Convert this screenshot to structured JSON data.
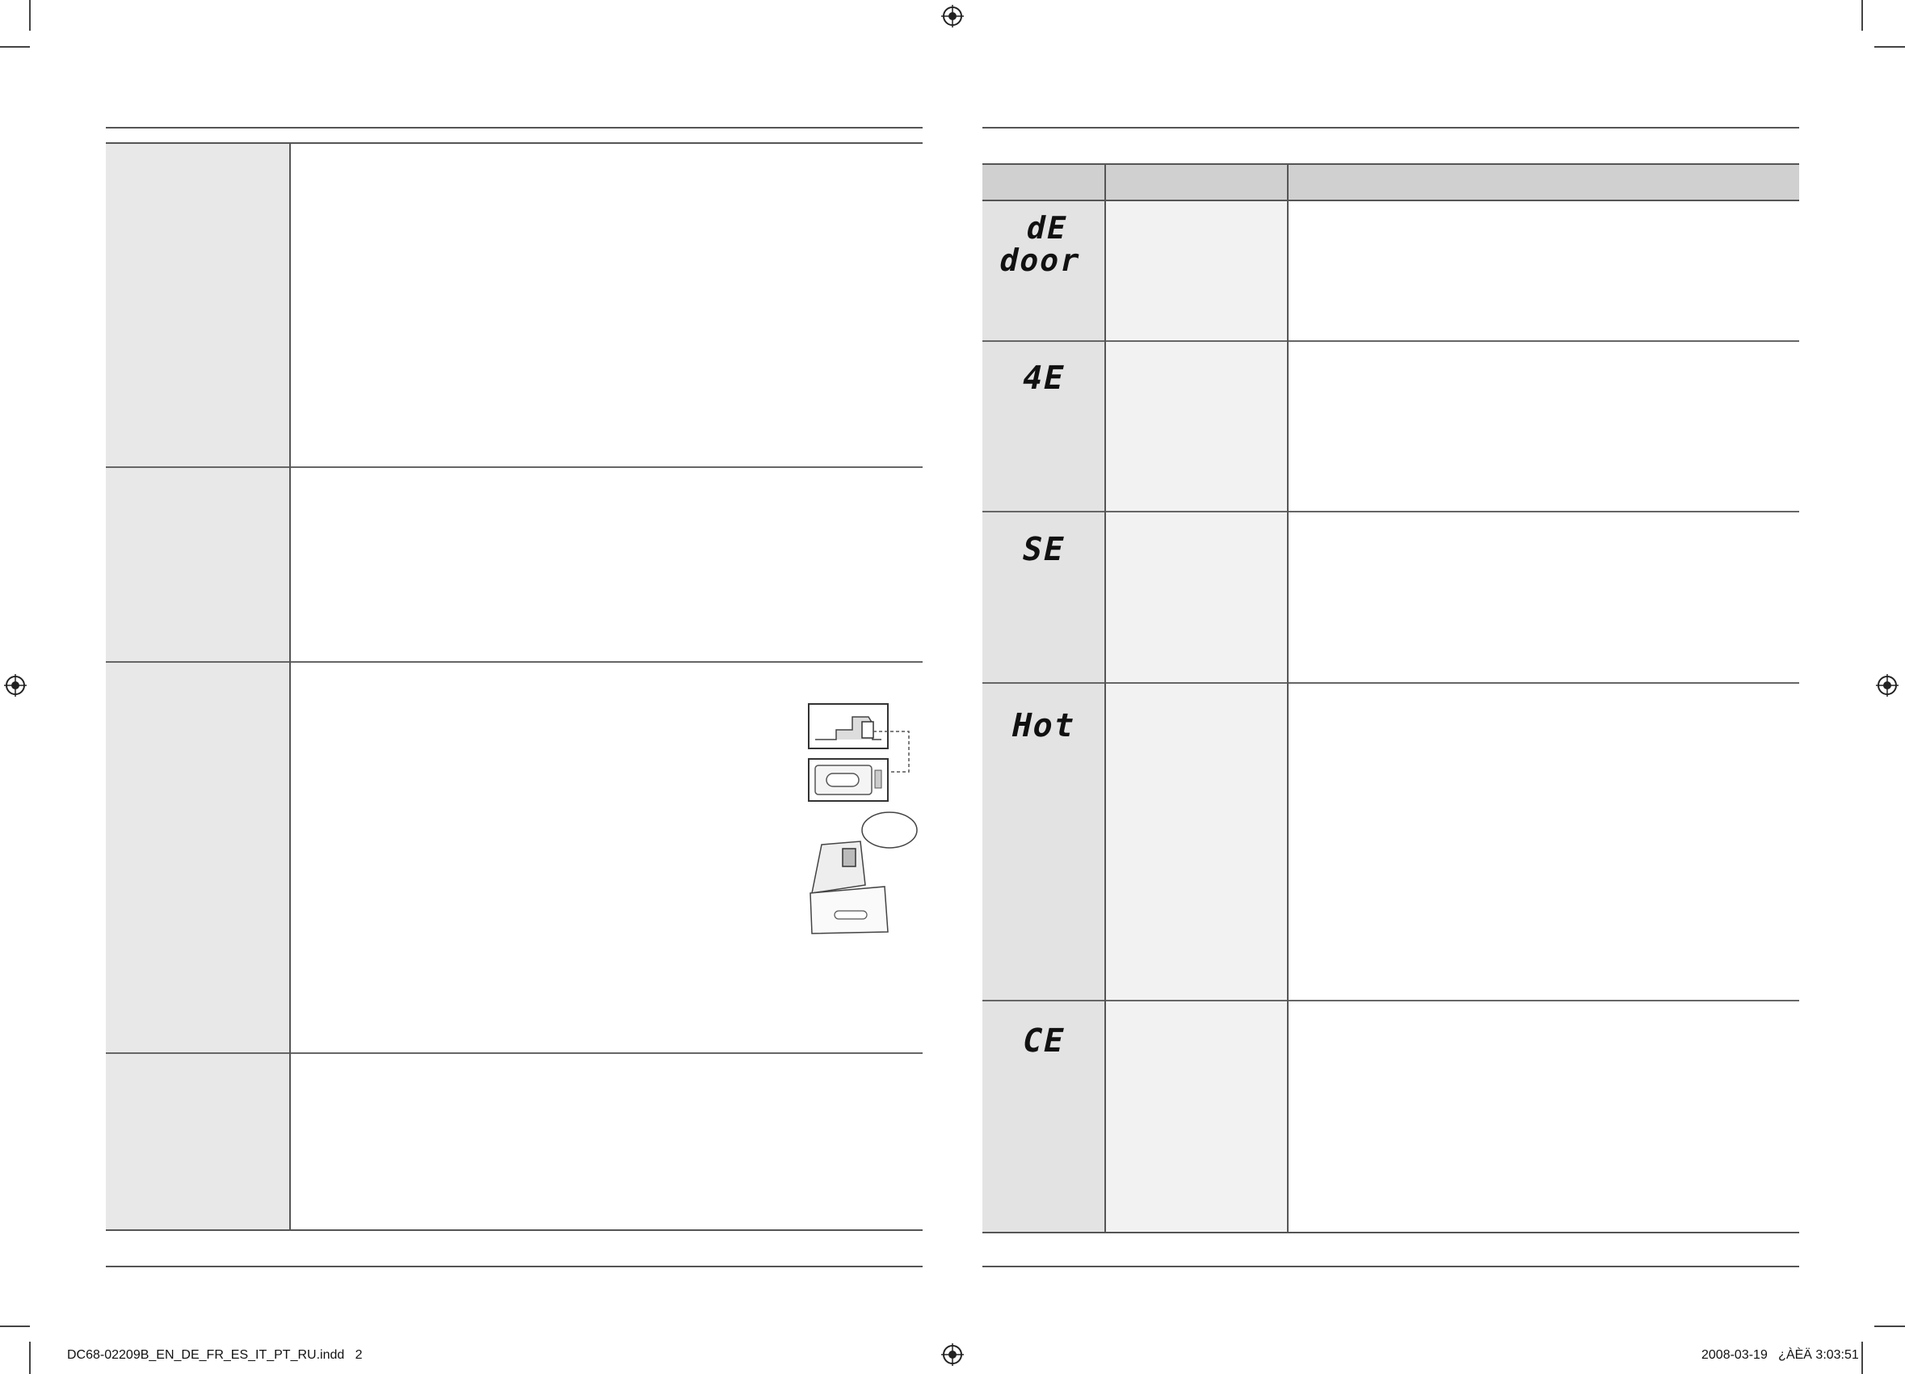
{
  "error_codes": [
    {
      "code_line1": "dE",
      "code_line2": "door"
    },
    {
      "code_line1": "4E",
      "code_line2": ""
    },
    {
      "code_line1": "SE",
      "code_line2": ""
    },
    {
      "code_line1": "Hot",
      "code_line2": ""
    },
    {
      "code_line1": "CE",
      "code_line2": ""
    }
  ],
  "footer": {
    "file_name": "DC68-02209B_EN_DE_FR_ES_IT_PT_RU.indd   2",
    "timestamp": "2008-03-19   ¿ÀÈÄ 3:03:51"
  }
}
